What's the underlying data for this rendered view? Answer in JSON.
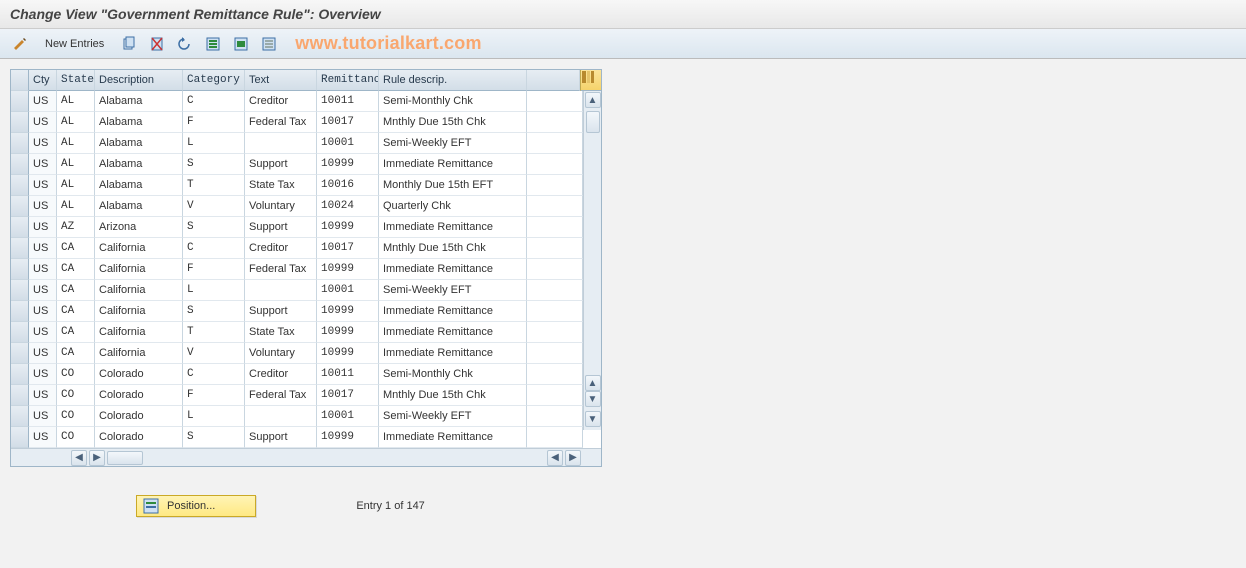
{
  "title": "Change View \"Government Remittance Rule\": Overview",
  "toolbar": {
    "new_entries_label": "New Entries"
  },
  "watermark": "www.tutorialkart.com",
  "columns": {
    "cty": "Cty",
    "state": "State",
    "desc": "Description",
    "cat": "Category",
    "text": "Text",
    "rem": "Remittanc...",
    "rule": "Rule descrip."
  },
  "rows": [
    {
      "cty": "US",
      "state": "AL",
      "desc": "Alabama",
      "cat": "C",
      "text": "Creditor",
      "rem": "10011",
      "rule": "Semi-Monthly Chk"
    },
    {
      "cty": "US",
      "state": "AL",
      "desc": "Alabama",
      "cat": "F",
      "text": "Federal Tax",
      "rem": "10017",
      "rule": "Mnthly Due 15th Chk"
    },
    {
      "cty": "US",
      "state": "AL",
      "desc": "Alabama",
      "cat": "L",
      "text": "",
      "rem": "10001",
      "rule": "Semi-Weekly EFT"
    },
    {
      "cty": "US",
      "state": "AL",
      "desc": "Alabama",
      "cat": "S",
      "text": "Support",
      "rem": "10999",
      "rule": "Immediate Remittance"
    },
    {
      "cty": "US",
      "state": "AL",
      "desc": "Alabama",
      "cat": "T",
      "text": "State Tax",
      "rem": "10016",
      "rule": "Monthly Due 15th EFT"
    },
    {
      "cty": "US",
      "state": "AL",
      "desc": "Alabama",
      "cat": "V",
      "text": "Voluntary",
      "rem": "10024",
      "rule": "Quarterly Chk"
    },
    {
      "cty": "US",
      "state": "AZ",
      "desc": "Arizona",
      "cat": "S",
      "text": "Support",
      "rem": "10999",
      "rule": "Immediate Remittance"
    },
    {
      "cty": "US",
      "state": "CA",
      "desc": "California",
      "cat": "C",
      "text": "Creditor",
      "rem": "10017",
      "rule": "Mnthly Due 15th Chk"
    },
    {
      "cty": "US",
      "state": "CA",
      "desc": "California",
      "cat": "F",
      "text": "Federal Tax",
      "rem": "10999",
      "rule": "Immediate Remittance"
    },
    {
      "cty": "US",
      "state": "CA",
      "desc": "California",
      "cat": "L",
      "text": "",
      "rem": "10001",
      "rule": "Semi-Weekly EFT"
    },
    {
      "cty": "US",
      "state": "CA",
      "desc": "California",
      "cat": "S",
      "text": "Support",
      "rem": "10999",
      "rule": "Immediate Remittance"
    },
    {
      "cty": "US",
      "state": "CA",
      "desc": "California",
      "cat": "T",
      "text": "State Tax",
      "rem": "10999",
      "rule": "Immediate Remittance"
    },
    {
      "cty": "US",
      "state": "CA",
      "desc": "California",
      "cat": "V",
      "text": "Voluntary",
      "rem": "10999",
      "rule": "Immediate Remittance"
    },
    {
      "cty": "US",
      "state": "CO",
      "desc": "Colorado",
      "cat": "C",
      "text": "Creditor",
      "rem": "10011",
      "rule": "Semi-Monthly Chk"
    },
    {
      "cty": "US",
      "state": "CO",
      "desc": "Colorado",
      "cat": "F",
      "text": "Federal Tax",
      "rem": "10017",
      "rule": "Mnthly Due 15th Chk"
    },
    {
      "cty": "US",
      "state": "CO",
      "desc": "Colorado",
      "cat": "L",
      "text": "",
      "rem": "10001",
      "rule": "Semi-Weekly EFT"
    },
    {
      "cty": "US",
      "state": "CO",
      "desc": "Colorado",
      "cat": "S",
      "text": "Support",
      "rem": "10999",
      "rule": "Immediate Remittance"
    }
  ],
  "footer": {
    "position_label": "Position...",
    "entry_text": "Entry 1 of 147"
  }
}
